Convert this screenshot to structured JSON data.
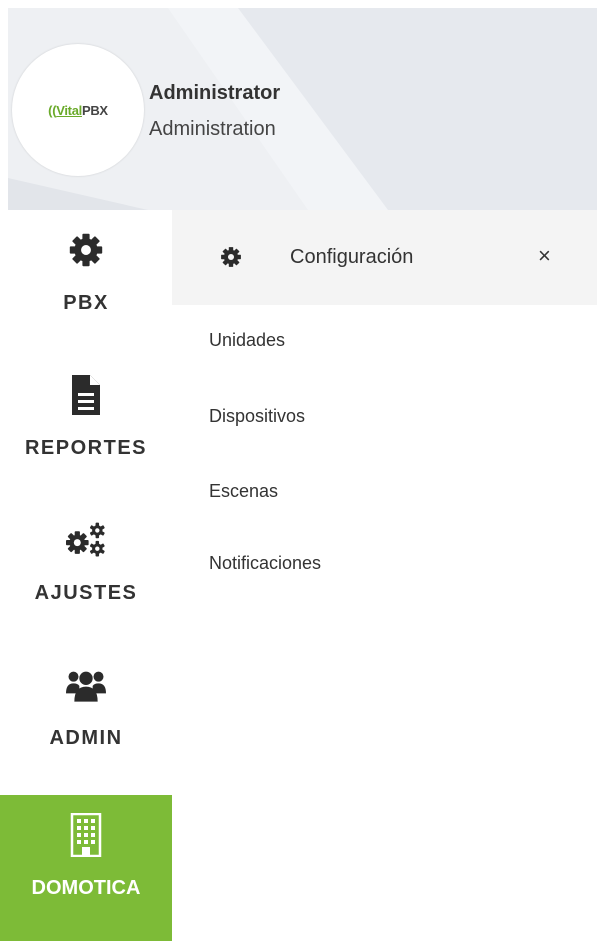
{
  "user": {
    "name": "Administrator",
    "role": "Administration",
    "logo": {
      "brand": "Vital",
      "suffix": "PBX",
      "brand_color": "#6aaa2a"
    }
  },
  "nav": {
    "items": [
      {
        "label": "PBX",
        "icon": "gear-icon"
      },
      {
        "label": "REPORTES",
        "icon": "document-icon"
      },
      {
        "label": "AJUSTES",
        "icon": "cogs-icon"
      },
      {
        "label": "ADMIN",
        "icon": "users-icon"
      },
      {
        "label": "DOMOTICA",
        "icon": "building-icon",
        "active": true
      }
    ],
    "active_color": "#7dbb37"
  },
  "panel": {
    "title": "Configuración",
    "icon": "gear-icon",
    "close_label": "×",
    "items": [
      "Unidades",
      "Dispositivos",
      "Escenas",
      "Notificaciones"
    ]
  }
}
